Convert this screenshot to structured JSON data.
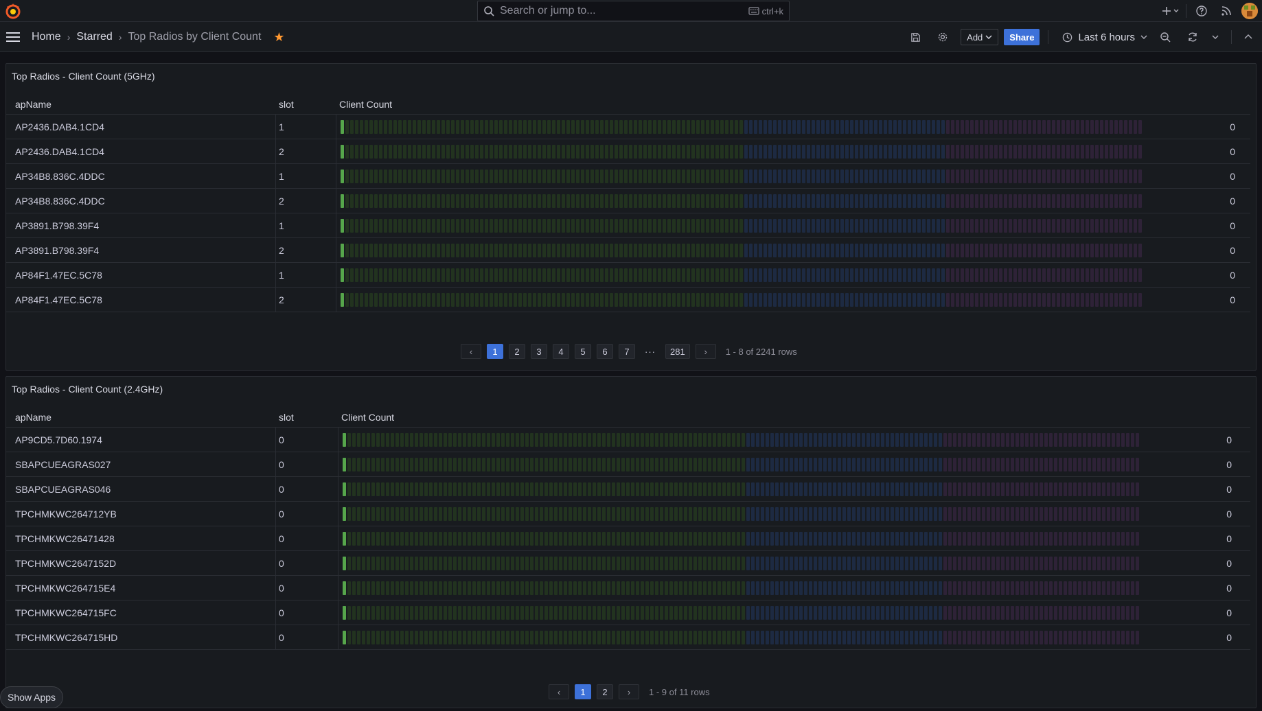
{
  "topbar": {
    "search_placeholder": "Search or jump to...",
    "search_shortcut": "ctrl+k",
    "icons": [
      "grafana-logo-icon",
      "search-icon",
      "keyboard-icon",
      "plus-icon",
      "help-icon",
      "rss-icon",
      "avatar"
    ]
  },
  "breadcrumb": {
    "home": "Home",
    "starred": "Starred",
    "current": "Top Radios by Client Count"
  },
  "toolbar": {
    "add_label": "Add",
    "share_label": "Share",
    "time_range": "Last 6 hours"
  },
  "colors": {
    "accent": "#3d71d9",
    "star": "#ff9830",
    "gauge_green_lit": "#56a64b",
    "gauge_green": "#22331f",
    "gauge_blue": "#1d2a42",
    "gauge_purple": "#2e2237"
  },
  "panel1": {
    "title": "Top Radios - Client Count (5GHz)",
    "headers": {
      "name": "apName",
      "slot": "slot",
      "count": "Client Count"
    },
    "rows": [
      {
        "name": "AP2436.DAB4.1CD4",
        "slot": "1",
        "value": "0"
      },
      {
        "name": "AP2436.DAB4.1CD4",
        "slot": "2",
        "value": "0"
      },
      {
        "name": "AP34B8.836C.4DDC",
        "slot": "1",
        "value": "0"
      },
      {
        "name": "AP34B8.836C.4DDC",
        "slot": "2",
        "value": "0"
      },
      {
        "name": "AP3891.B798.39F4",
        "slot": "1",
        "value": "0"
      },
      {
        "name": "AP3891.B798.39F4",
        "slot": "2",
        "value": "0"
      },
      {
        "name": "AP84F1.47EC.5C78",
        "slot": "1",
        "value": "0"
      },
      {
        "name": "AP84F1.47EC.5C78",
        "slot": "2",
        "value": "0"
      }
    ],
    "pagination": {
      "pages": [
        "1",
        "2",
        "3",
        "4",
        "5",
        "6",
        "7"
      ],
      "ellipsis": "···",
      "last": "281",
      "active": "1",
      "info": "1 - 8 of 2241 rows"
    }
  },
  "panel2": {
    "title": "Top Radios - Client Count (2.4GHz)",
    "headers": {
      "name": "apName",
      "slot": "slot",
      "count": "Client Count"
    },
    "rows": [
      {
        "name": "AP9CD5.7D60.1974",
        "slot": "0",
        "value": "0"
      },
      {
        "name": "SBAPCUEAGRAS027",
        "slot": "0",
        "value": "0"
      },
      {
        "name": "SBAPCUEAGRAS046",
        "slot": "0",
        "value": "0"
      },
      {
        "name": "TPCHMKWC264712YB",
        "slot": "0",
        "value": "0"
      },
      {
        "name": "TPCHMKWC26471428",
        "slot": "0",
        "value": "0"
      },
      {
        "name": "TPCHMKWC2647152D",
        "slot": "0",
        "value": "0"
      },
      {
        "name": "TPCHMKWC264715E4",
        "slot": "0",
        "value": "0"
      },
      {
        "name": "TPCHMKWC264715FC",
        "slot": "0",
        "value": "0"
      },
      {
        "name": "TPCHMKWC264715HD",
        "slot": "0",
        "value": "0"
      }
    ],
    "pagination": {
      "pages": [
        "1",
        "2"
      ],
      "active": "1",
      "info": "1 - 9 of 11 rows"
    }
  },
  "show_apps": "Show Apps"
}
